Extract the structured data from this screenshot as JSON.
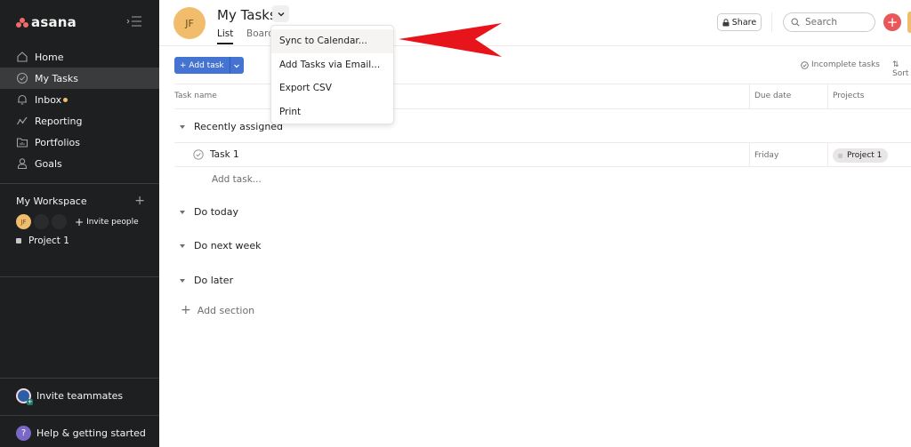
{
  "app": {
    "brand": "asana",
    "accent_color": "#f06a6a"
  },
  "sidebar": {
    "nav_items": [
      {
        "label": "Home",
        "icon": "home-icon"
      },
      {
        "label": "My Tasks",
        "icon": "check-circle-icon",
        "active": true
      },
      {
        "label": "Inbox",
        "icon": "bell-icon",
        "badge": "unread-dot"
      },
      {
        "label": "Reporting",
        "icon": "chart-line-icon"
      },
      {
        "label": "Portfolios",
        "icon": "portfolio-icon"
      },
      {
        "label": "Goals",
        "icon": "person-icon"
      }
    ],
    "workspace": {
      "title": "My Workspace",
      "avatar_initials": "JF",
      "invite_people_label": "Invite people",
      "projects": [
        {
          "label": "Project 1"
        }
      ]
    },
    "invite_teammates_label": "Invite teammates",
    "help_label": "Help & getting started",
    "help_icon_glyph": "?"
  },
  "header": {
    "avatar_initials": "JF",
    "title": "My Tasks",
    "tabs": [
      {
        "label": "List",
        "active": true
      },
      {
        "label": "Board"
      }
    ],
    "share_label": "Share",
    "search_placeholder": "Search",
    "create_glyph": "+"
  },
  "toolbar": {
    "add_task_label": "+ Add task",
    "filter_label": "Incomplete tasks",
    "sort_label": "Sort"
  },
  "table": {
    "columns": [
      "Task name",
      "Due date",
      "Projects"
    ],
    "sections": [
      {
        "name": "Recently assigned",
        "tasks": [
          {
            "name": "Task 1",
            "due": "Friday",
            "project": "Project 1"
          }
        ],
        "add_task_label": "Add task..."
      },
      {
        "name": "Do today",
        "tasks": []
      },
      {
        "name": "Do next week",
        "tasks": []
      },
      {
        "name": "Do later",
        "tasks": []
      }
    ],
    "add_section_label": "Add section"
  },
  "dropdown_menu": {
    "items": [
      {
        "label": "Sync to Calendar...",
        "highlighted": true
      },
      {
        "label": "Add Tasks via Email..."
      },
      {
        "label": "Export CSV"
      },
      {
        "label": "Print"
      }
    ]
  },
  "annotation": {
    "type": "red-arrow",
    "points_to": "Sync to Calendar...",
    "color": "#e8141b"
  }
}
